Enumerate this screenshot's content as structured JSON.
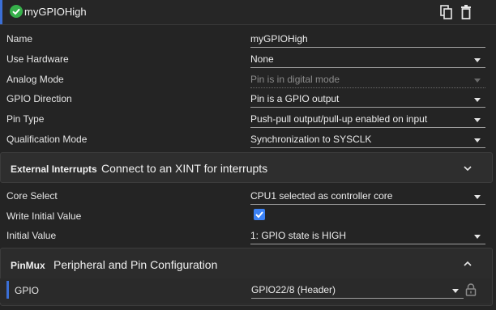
{
  "header": {
    "title": "myGPIOHigh",
    "icons": [
      "check-circle-icon",
      "copy-icon",
      "trash-icon"
    ]
  },
  "fields": {
    "name": {
      "label": "Name",
      "value": "myGPIOHigh"
    },
    "use_hardware": {
      "label": "Use Hardware",
      "value": "None"
    },
    "analog_mode": {
      "label": "Analog Mode",
      "value": "Pin is in digital mode"
    },
    "gpio_direction": {
      "label": "GPIO Direction",
      "value": "Pin is a GPIO output"
    },
    "pin_type": {
      "label": "Pin Type",
      "value": "Push-pull output/pull-up enabled on input"
    },
    "qualification_mode": {
      "label": "Qualification Mode",
      "value": "Synchronization to SYSCLK"
    }
  },
  "external_interrupts": {
    "key": "External Interrupts",
    "description": "Connect to an XINT for interrupts"
  },
  "fields2": {
    "core_select": {
      "label": "Core Select",
      "value": "CPU1 selected as controller core"
    },
    "write_initial": {
      "label": "Write Initial Value",
      "checked": true
    },
    "initial_value": {
      "label": "Initial Value",
      "value": "1: GPIO state is HIGH"
    }
  },
  "pinmux": {
    "key": "PinMux",
    "description": "Peripheral and Pin Configuration",
    "gpio": {
      "label": "GPIO",
      "value": "GPIO22/8 (Header)"
    }
  },
  "colors": {
    "accent": "#3b6fd6",
    "check": "#36b04a",
    "checkbox": "#3b82f6"
  }
}
